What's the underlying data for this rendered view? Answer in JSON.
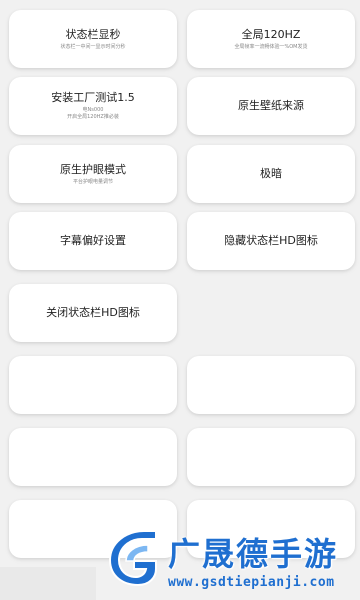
{
  "cards": [
    {
      "title": "状态栏显秒",
      "sub": "状态栏一中间一显示时间分秒"
    },
    {
      "title": "全局120HZ",
      "sub": "全局帧率一流畅体验一%OM发烫"
    },
    {
      "title": "安装工厂测试1.5",
      "sub": "电Ns000\n开启全局120HZ推必装"
    },
    {
      "title": "原生壁纸来源",
      "sub": ""
    },
    {
      "title": "原生护眼模式",
      "sub": "平台护眼电量调节"
    },
    {
      "title": "极暗",
      "sub": ""
    },
    {
      "title": "字幕偏好设置",
      "sub": ""
    },
    {
      "title": "隐藏状态栏HD图标",
      "sub": ""
    },
    {
      "title": "关闭状态栏HD图标",
      "sub": ""
    }
  ],
  "watermark": {
    "name": "广晟德手游",
    "url": "www.gsdtiepianji.com",
    "color": "#1f6fd0"
  }
}
